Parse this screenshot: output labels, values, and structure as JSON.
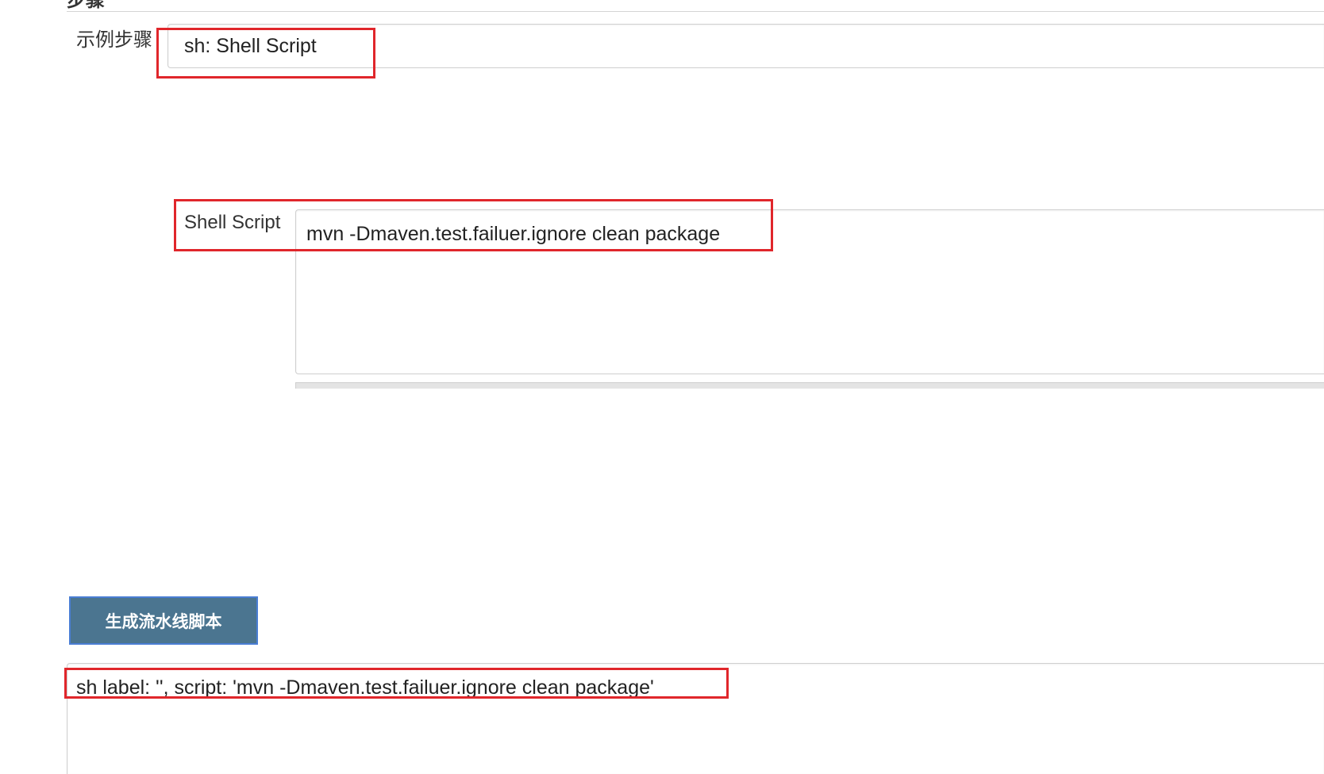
{
  "section": {
    "title": "步骤"
  },
  "step": {
    "label": "示例步骤",
    "selected_value": "sh: Shell Script"
  },
  "shell_script": {
    "label": "Shell Script",
    "value": "mvn -Dmaven.test.failuer.ignore clean package"
  },
  "actions": {
    "generate_label": "生成流水线脚本"
  },
  "output": {
    "value": "sh label: '', script: 'mvn -Dmaven.test.failuer.ignore clean package'"
  },
  "colors": {
    "annotation_red": "#e0262b",
    "button_bg": "#4b7590",
    "button_border": "#4a7ed4"
  }
}
